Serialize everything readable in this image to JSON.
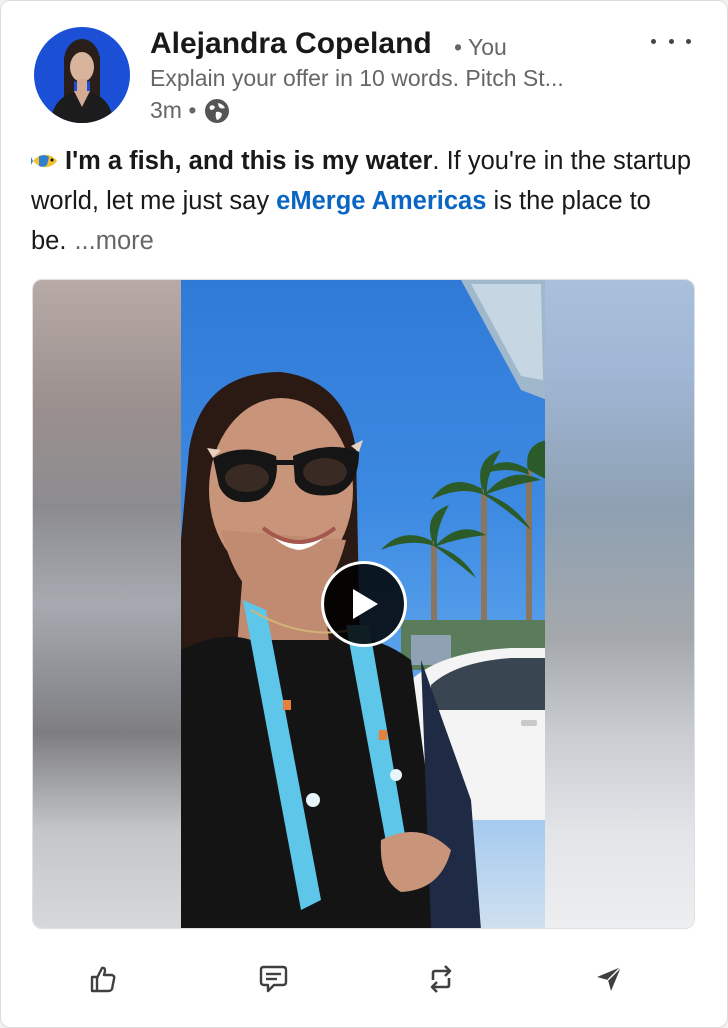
{
  "post": {
    "author": {
      "name": "Alejandra Copeland",
      "relation": "• You",
      "headline": "Explain your offer in 10 words. Pitch St...",
      "timestamp": "3m •"
    },
    "body": {
      "emoji": "fish-icon",
      "bold_text": "I'm a fish, and this is my water",
      "text_part1": ". If you're in the startup world, let me just say ",
      "link_text": "eMerge Americas",
      "text_part2": " is the place to be.",
      "see_more": "...more"
    },
    "media": {
      "type": "video"
    },
    "actions": [
      {
        "icon": "like-icon"
      },
      {
        "icon": "comment-icon"
      },
      {
        "icon": "repost-icon"
      },
      {
        "icon": "send-icon"
      }
    ]
  },
  "colors": {
    "link": "#0a66c2",
    "muted": "#666666",
    "avatar_bg": "#1a4fd6"
  }
}
